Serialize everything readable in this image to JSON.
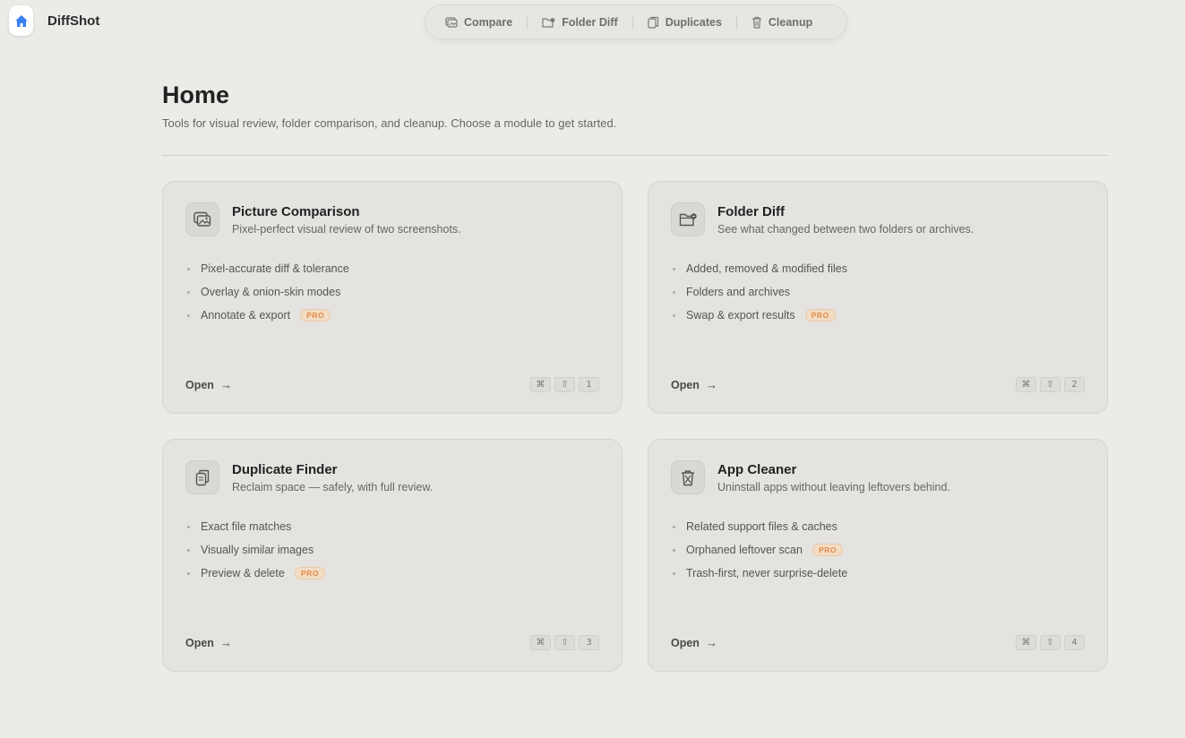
{
  "app": {
    "name": "DiffShot"
  },
  "nav": [
    {
      "label": "Compare",
      "icon": "compare-icon"
    },
    {
      "label": "Folder Diff",
      "icon": "folder-diff-icon"
    },
    {
      "label": "Duplicates",
      "icon": "duplicates-icon"
    },
    {
      "label": "Cleanup",
      "icon": "cleanup-icon"
    }
  ],
  "page": {
    "title": "Home",
    "subtitle": "Tools for visual review, folder comparison, and cleanup. Choose a module to get started."
  },
  "pro_label": "PRO",
  "cards": [
    {
      "title": "Picture Comparison",
      "description": "Pixel-perfect visual review of two screenshots.",
      "icon": "picture-comparison-icon",
      "features": [
        {
          "text": "Pixel-accurate diff & tolerance"
        },
        {
          "text": "Overlay & onion-skin modes"
        },
        {
          "text": "Annotate & export",
          "pro": true
        }
      ],
      "open_label": "Open",
      "shortcut": [
        "⌘",
        "⇧",
        "1"
      ]
    },
    {
      "title": "Folder Diff",
      "description": "See what changed between two folders or archives.",
      "icon": "folder-diff-icon",
      "features": [
        {
          "text": "Added, removed & modified files"
        },
        {
          "text": "Folders and archives"
        },
        {
          "text": "Swap & export results",
          "pro": true
        }
      ],
      "open_label": "Open",
      "shortcut": [
        "⌘",
        "⇧",
        "2"
      ]
    },
    {
      "title": "Duplicate Finder",
      "description": "Reclaim space — safely, with full review.",
      "icon": "duplicates-icon",
      "features": [
        {
          "text": "Exact file matches"
        },
        {
          "text": "Visually similar images"
        },
        {
          "text": "Preview & delete",
          "pro": true
        }
      ],
      "open_label": "Open",
      "shortcut": [
        "⌘",
        "⇧",
        "3"
      ]
    },
    {
      "title": "App Cleaner",
      "description": "Uninstall apps without leaving leftovers behind.",
      "icon": "trash-icon",
      "features": [
        {
          "text": "Related support files & caches"
        },
        {
          "text": "Orphaned leftover scan",
          "pro": true
        },
        {
          "text": "Trash-first, never surprise-delete"
        }
      ],
      "open_label": "Open",
      "shortcut": [
        "⌘",
        "⇧",
        "4"
      ]
    }
  ],
  "colors": {
    "background": "#ecebe8",
    "accent": "#3b7ff5",
    "pro": "#e08b48"
  }
}
